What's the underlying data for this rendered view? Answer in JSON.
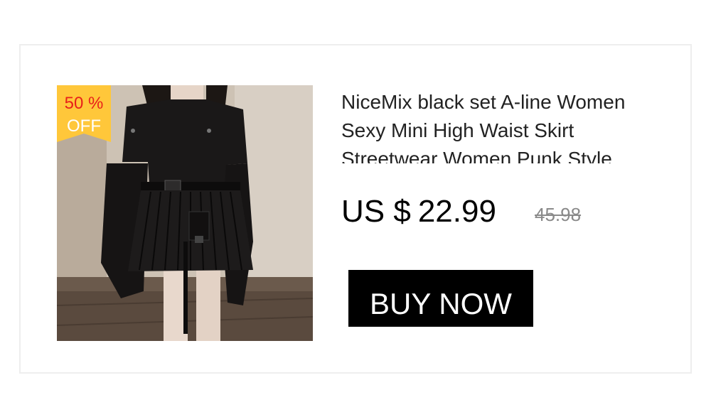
{
  "product": {
    "title": "NiceMix black set A-line Women Sexy Mini High Waist Skirt Streetwear Women Punk Style",
    "image_icon": "product-photo",
    "discount": {
      "percent": "50 %",
      "label": "OFF",
      "badge_color": "#ffc73a",
      "text_color": "#e8201a"
    },
    "price": {
      "currency": "US $",
      "amount": "22.99",
      "original": "45.98"
    },
    "buy_label": "BUY NOW"
  },
  "colors": {
    "button_bg": "#000000",
    "button_text": "#ffffff",
    "price_text": "#000000",
    "original_price_text": "#8a8a8a"
  }
}
